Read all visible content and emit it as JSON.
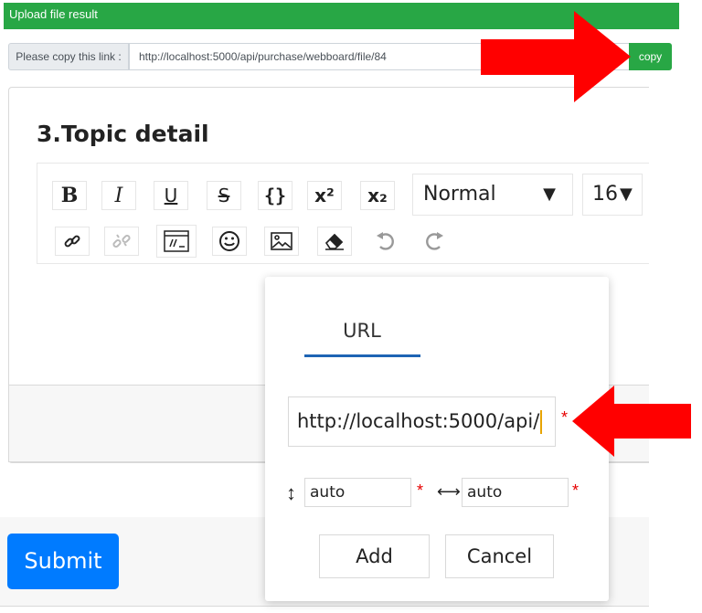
{
  "banner": {
    "text": "Upload file result"
  },
  "link": {
    "prefix": "Please copy this link :",
    "url": "http://localhost:5000/api/purchase/webboard/file/84",
    "copy_label": "copy"
  },
  "editor": {
    "section_title": "3.Topic detail",
    "toolbar": {
      "bold": "B",
      "italic": "I",
      "underline": "U",
      "strike": "S",
      "code": "{}",
      "superscript": "x²",
      "subscript": "x₂",
      "format_value": "Normal",
      "size_value": "16"
    }
  },
  "image_popup": {
    "tab_label": "URL",
    "url_value": "http://localhost:5000/api/",
    "required_mark": "*",
    "height_value": "auto",
    "width_value": "auto",
    "add_label": "Add",
    "cancel_label": "Cancel"
  },
  "form": {
    "submit_label": "Submit"
  },
  "colors": {
    "success": "#28a745",
    "primary": "#007bff",
    "required": "#e60000",
    "annotation_arrow": "#ff0000"
  }
}
